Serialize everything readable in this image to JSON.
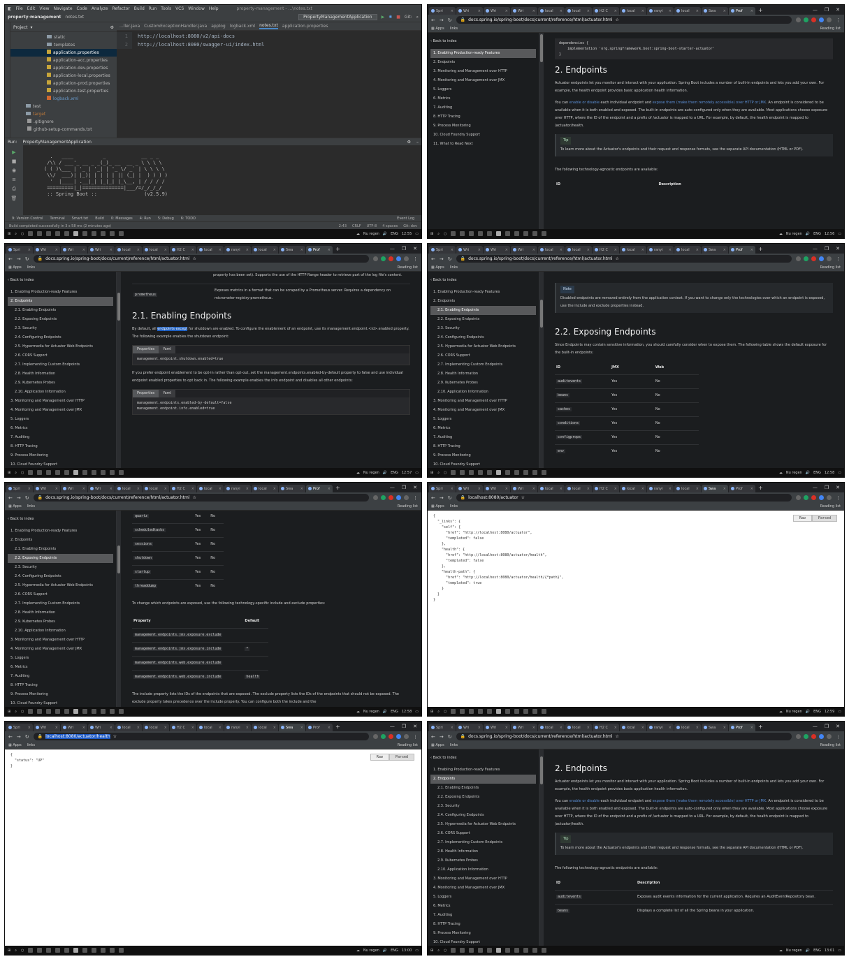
{
  "browser": {
    "tabs": [
      "Spri",
      "Wri",
      "Wri",
      "Wri",
      "local",
      "local",
      "H2 C",
      "local",
      "ranyi",
      "local",
      "Swa",
      "Prof"
    ],
    "new_tab": "+",
    "window_buttons": [
      "—",
      "❐",
      "✕"
    ],
    "bookmarks": {
      "apps": "Apps",
      "links": "links",
      "reading_list": "Reading list"
    },
    "docs_url": "docs.spring.io/spring-boot/docs/current/reference/html/actuator.html",
    "url_actuator": "localhost:8080/actuator",
    "url_health": "localhost:8080/actuator/health"
  },
  "taskbar": {
    "weather": "Nu regen",
    "lang": "ENG",
    "times": [
      "12:55",
      "12:56",
      "12:57",
      "12:58",
      "12:58",
      "12:59",
      "13:00",
      "13:01"
    ]
  },
  "ide": {
    "menu": [
      "File",
      "Edit",
      "View",
      "Navigate",
      "Code",
      "Analyze",
      "Refactor",
      "Build",
      "Run",
      "Tools",
      "VCS",
      "Window",
      "Help"
    ],
    "window_title": "property-management - ...\\notes.txt",
    "breadcrumb": "property-management",
    "breadcrumb_file": "notes.txt",
    "run_config": "PropertyManagementApplication",
    "git_label": "Git:",
    "project_label": "Project",
    "tree": [
      {
        "name": "static",
        "kind": "folder"
      },
      {
        "name": "templates",
        "kind": "folder"
      },
      {
        "name": "application.properties",
        "kind": "prop",
        "selected": true
      },
      {
        "name": "application-acc.properties",
        "kind": "prop"
      },
      {
        "name": "application-dev.properties",
        "kind": "prop"
      },
      {
        "name": "application-local.properties",
        "kind": "prop"
      },
      {
        "name": "application-prod.properties",
        "kind": "prop"
      },
      {
        "name": "application-test.properties",
        "kind": "prop"
      },
      {
        "name": "logback.xml",
        "kind": "xml"
      },
      {
        "name": "test",
        "kind": "folder"
      },
      {
        "name": "target",
        "kind": "folder"
      },
      {
        "name": ".gitignore",
        "kind": "file"
      },
      {
        "name": "github-setup-commands.txt",
        "kind": "file"
      }
    ],
    "editor_tabs": [
      "...ller.java",
      "CustomExceptionHandler.java",
      "applog",
      "logback.xml",
      "notes.txt",
      "application.properties"
    ],
    "editor_lines": [
      "http://localhost:8080/v2/api-docs",
      "http://localhost:8080/swagger-ui/index.html"
    ],
    "run_label": "Run:",
    "run_tab": "PropertyManagementApplication",
    "banner": "  .   ____          _            __ _ _\n /\\\\ / ___'_ __ _ _(_)_ __  __ _ \\ \\ \\ \\\n( ( )\\___ | '_ | '_| | '_ \\/ _` | \\ \\ \\ \\\n \\\\/  ___)| |_)| | | | | || (_| |  ) ) ) )\n  '  |____| .__|_| |_|_| |_\\__, | / / / /\n =========|_|==============|___/=/_/_/_/\n :: Spring Boot ::                (v2.5.9)",
    "bottom_tabs": [
      "9: Version Control",
      "Terminal",
      "Smart.txt",
      "Build",
      "0: Messages",
      "4: Run",
      "5: Debug",
      "6: TODO"
    ],
    "event_log": "Event Log",
    "status": "Build completed successfully in 3 s 58 ms (2 minutes ago)",
    "status_right": [
      "2:43",
      "CRLF",
      "UTF-8",
      "4 spaces",
      "Git: dev"
    ]
  },
  "toc": {
    "back": "Back to index",
    "items": [
      {
        "t": "1. Enabling Production-ready Features",
        "lvl": 0
      },
      {
        "t": "2. Endpoints",
        "lvl": 0
      },
      {
        "t": "2.1. Enabling Endpoints",
        "lvl": 1
      },
      {
        "t": "2.2. Exposing Endpoints",
        "lvl": 1
      },
      {
        "t": "2.3. Security",
        "lvl": 1
      },
      {
        "t": "2.4. Configuring Endpoints",
        "lvl": 1
      },
      {
        "t": "2.5. Hypermedia for Actuator Web Endpoints",
        "lvl": 1
      },
      {
        "t": "2.6. CORS Support",
        "lvl": 1
      },
      {
        "t": "2.7. Implementing Custom Endpoints",
        "lvl": 1
      },
      {
        "t": "2.8. Health Information",
        "lvl": 1
      },
      {
        "t": "2.9. Kubernetes Probes",
        "lvl": 1
      },
      {
        "t": "2.10. Application Information",
        "lvl": 1
      },
      {
        "t": "3. Monitoring and Management over HTTP",
        "lvl": 0
      },
      {
        "t": "4. Monitoring and Management over JMX",
        "lvl": 0
      },
      {
        "t": "5. Loggers",
        "lvl": 0
      },
      {
        "t": "6. Metrics",
        "lvl": 0
      },
      {
        "t": "7. Auditing",
        "lvl": 0
      },
      {
        "t": "8. HTTP Tracing",
        "lvl": 0
      },
      {
        "t": "9. Process Monitoring",
        "lvl": 0
      },
      {
        "t": "10. Cloud Foundry Support",
        "lvl": 0
      },
      {
        "t": "11. What to Read Next",
        "lvl": 0
      }
    ]
  },
  "docs": {
    "dep_code": "dependencies {\n    implementation 'org.springframework.boot:spring-boot-starter-actuator'\n}",
    "h_endpoints": "2. Endpoints",
    "p_endpoints": "Actuator endpoints let you monitor and interact with your application. Spring Boot includes a number of built-in endpoints and lets you add your own. For example, the health endpoint provides basic application health information.",
    "p_enable_1": "You can ",
    "p_enable_link1": "enable or disable",
    "p_enable_2": " each individual endpoint and ",
    "p_enable_link2": "expose them (make them remotely accessible) over HTTP or JMX",
    "p_enable_3": ". An endpoint is considered to be available when it is both enabled and exposed. The built-in endpoints are auto-configured only when they are available. Most applications choose exposure over HTTP, where the ID of the endpoint and a prefix of /actuator is mapped to a URL. For example, by default, the health endpoint is mapped to /actuator/health.",
    "tip": "Tip",
    "tip_text": "To learn more about the Actuator's endpoints and their request and response formats, see the separate API documentation (HTML or PDF).",
    "tech_agnostic": "The following technology-agnostic endpoints are available:",
    "col_id": "ID",
    "col_desc": "Description",
    "row_audit": "auditevents",
    "row_audit_desc": "Exposes audit events information for the current application. Requires an AuditEventRepository bean.",
    "row_beans": "beans",
    "row_beans_desc": "Displays a complete list of all the Spring beans in your application.",
    "logfile_tail": "property has been set). Supports the use of the HTTP Range header to retrieve part of the log file's content.",
    "prometheus": "prometheus",
    "prometheus_desc": "Exposes metrics in a format that can be scraped by a Prometheus server. Requires a dependency on micrometer-registry-prometheus.",
    "h_enabling": "2.1. Enabling Endpoints",
    "p_enabling_1": "By default, all ",
    "p_enabling_hl": "endpoints except",
    "p_enabling_2": " for shutdown are enabled. To configure the enablement of an endpoint, use its management.endpoint.<id>.enabled property. The following example enables the shutdown endpoint:",
    "code_tabs": [
      "Properties",
      "Yaml"
    ],
    "code_shutdown": "management.endpoint.shutdown.enabled=true",
    "p_optin": "If you prefer endpoint enablement to be opt-in rather than opt-out, set the management.endpoints.enabled-by-default property to false and use individual endpoint enabled properties to opt back in. The following example enables the info endpoint and disables all other endpoints:",
    "code_info": "management.endpoints.enabled-by-default=false\nmanagement.endpoint.info.enabled=true",
    "note": "Note",
    "note_text": "Disabled endpoints are removed entirely from the application context. If you want to change only the technologies over which an endpoint is exposed, use the include and exclude properties instead.",
    "h_exposing": "2.2. Exposing Endpoints",
    "p_exposing": "Since Endpoints may contain sensitive information, you should carefully consider when to expose them. The following table shows the default exposure for the built-in endpoints:",
    "col_jmx": "JMX",
    "col_web": "Web",
    "exp_rows_a": [
      [
        "auditevents",
        "Yes",
        "No"
      ],
      [
        "beans",
        "Yes",
        "No"
      ],
      [
        "caches",
        "Yes",
        "No"
      ],
      [
        "conditions",
        "Yes",
        "No"
      ],
      [
        "configprops",
        "Yes",
        "No"
      ],
      [
        "env",
        "Yes",
        "No"
      ]
    ],
    "exp_rows_b": [
      [
        "quartz",
        "Yes",
        "No"
      ],
      [
        "scheduledtasks",
        "Yes",
        "No"
      ],
      [
        "sessions",
        "Yes",
        "No"
      ],
      [
        "shutdown",
        "Yes",
        "No"
      ],
      [
        "startup",
        "Yes",
        "No"
      ],
      [
        "threaddump",
        "Yes",
        "No"
      ]
    ],
    "p_change": "To change which endpoints are exposed, use the following technology-specific include and exclude properties:",
    "col_property": "Property",
    "col_default": "Default",
    "prop_rows": [
      [
        "management.endpoints.jmx.exposure.exclude",
        ""
      ],
      [
        "management.endpoints.jmx.exposure.include",
        "*"
      ],
      [
        "management.endpoints.web.exposure.exclude",
        ""
      ],
      [
        "management.endpoints.web.exposure.include",
        "health"
      ]
    ],
    "p_include": "The include property lists the IDs of the endpoints that are exposed. The exclude property lists the IDs of the endpoints that should not be exposed. The exclude property takes precedence over the include property. You can configure both the include and the"
  },
  "json": {
    "raw": "Raw",
    "parsed": "Parsed",
    "actuator": "{\n  \"_links\": {\n    \"self\": {\n      \"href\": \"http://localhost:8080/actuator\",\n      \"templated\": false\n    },\n    \"health\": {\n      \"href\": \"http://localhost:8080/actuator/health\",\n      \"templated\": false\n    },\n    \"health-path\": {\n      \"href\": \"http://localhost:8080/actuator/health/{*path}\",\n      \"templated\": true\n    }\n  }\n}",
    "health": "{\n  \"status\": \"UP\"\n}"
  }
}
